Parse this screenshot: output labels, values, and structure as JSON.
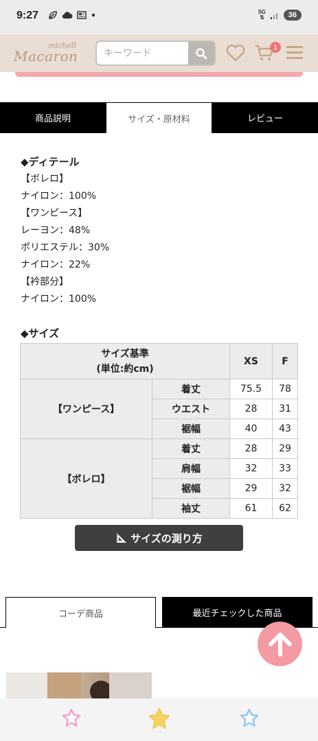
{
  "status_bar": {
    "time": "9:27",
    "network": "5G",
    "battery": "36"
  },
  "header": {
    "logo_small": "michell",
    "logo_big": "Macaron",
    "search_placeholder": "キーワード",
    "cart_count": "1"
  },
  "tabs": [
    {
      "label": "商品説明"
    },
    {
      "label": "サイズ・原材料"
    },
    {
      "label": "レビュー"
    }
  ],
  "details": {
    "heading": "◆ディテール",
    "lines": [
      "【ボレロ】",
      "ナイロン：100%",
      "【ワンピース】",
      "レーヨン：48%",
      "ポリエステル：30%",
      "ナイロン：22%",
      "【衿部分】",
      "ナイロン：100%"
    ]
  },
  "size": {
    "heading": "◆サイズ",
    "header_line1": "サイズ基準",
    "header_line2": "(単位:約cm)",
    "columns": [
      "XS",
      "F"
    ],
    "groups": [
      {
        "name": "【ワンピース】",
        "rows": [
          {
            "label": "着丈",
            "values": [
              "75.5",
              "78"
            ]
          },
          {
            "label": "ウエスト",
            "values": [
              "28",
              "31"
            ]
          },
          {
            "label": "裾幅",
            "values": [
              "40",
              "43"
            ]
          }
        ]
      },
      {
        "name": "【ボレロ】",
        "rows": [
          {
            "label": "着丈",
            "values": [
              "28",
              "29"
            ]
          },
          {
            "label": "肩幅",
            "values": [
              "32",
              "33"
            ]
          },
          {
            "label": "裾幅",
            "values": [
              "29",
              "32"
            ]
          },
          {
            "label": "袖丈",
            "values": [
              "61",
              "62"
            ]
          }
        ]
      }
    ],
    "measure_button": "サイズの測り方"
  },
  "lower_tabs": [
    {
      "label": "コーデ商品"
    },
    {
      "label": "最近チェックした商品"
    }
  ],
  "colors": {
    "header_bg": "#e9ddd4",
    "accent_pink": "#f49aa3",
    "star_pink": "#f3a0cf",
    "star_yellow": "#f7d35f",
    "star_blue": "#8fc6f0"
  }
}
